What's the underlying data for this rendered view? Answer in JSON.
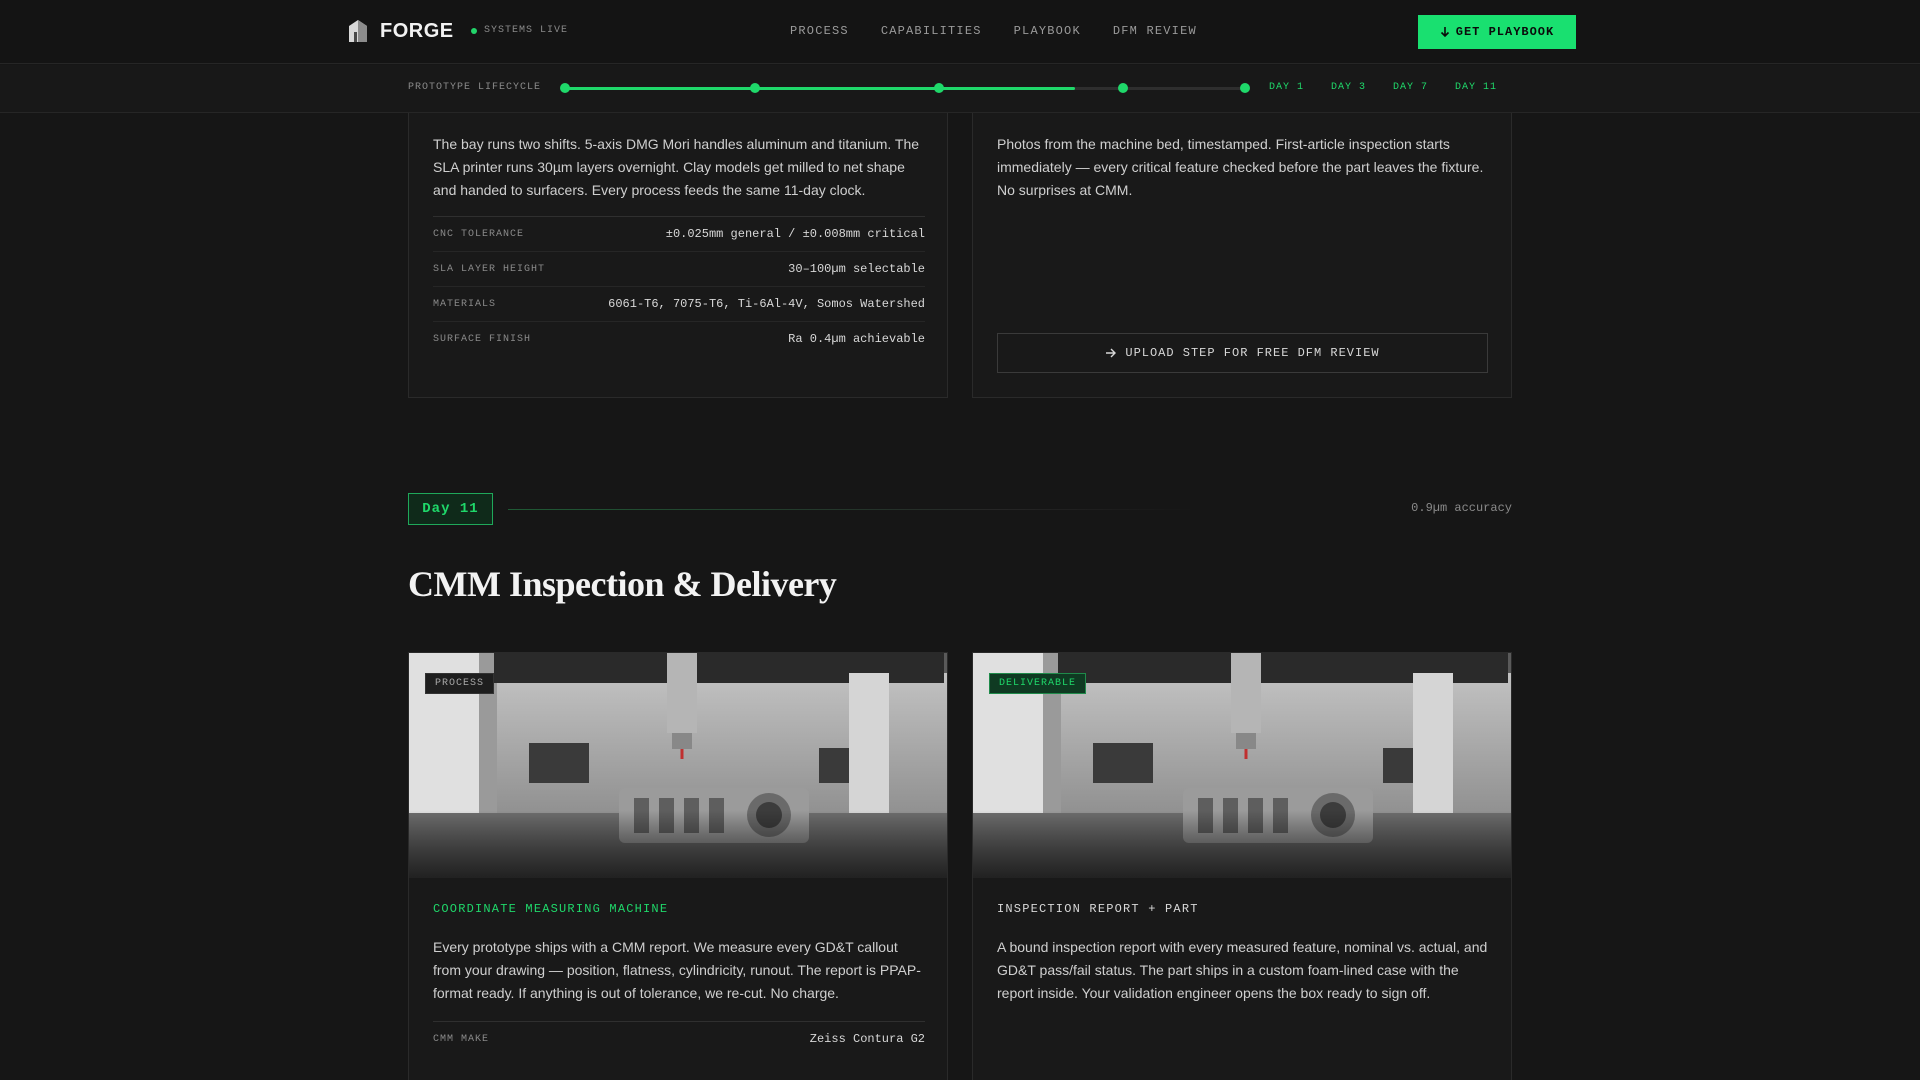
{
  "nav": {
    "brand": "FORGE",
    "status": "SYSTEMS LIVE",
    "links": [
      "PROCESS",
      "CAPABILITIES",
      "PLAYBOOK",
      "DFM REVIEW"
    ],
    "cta": "GET PLAYBOOK"
  },
  "lifecycle": {
    "label": "PROTOTYPE LIFECYCLE",
    "progress_percent": 75,
    "milestones_percent": [
      0,
      28,
      55,
      82,
      100
    ],
    "days": [
      "DAY 1",
      "DAY 3",
      "DAY 7",
      "DAY 11"
    ]
  },
  "shop_card": {
    "text": "The bay runs two shifts. 5-axis DMG Mori handles aluminum and titanium. The SLA printer runs 30µm layers overnight. Clay models get milled to net shape and handed to surfacers. Every process feeds the same 11-day clock.",
    "specs": [
      {
        "key": "CNC TOLERANCE",
        "value": "±0.025mm general / ±0.008mm critical"
      },
      {
        "key": "SLA LAYER HEIGHT",
        "value": "30–100µm selectable"
      },
      {
        "key": "MATERIALS",
        "value": "6061-T6, 7075-T6, Ti-6Al-4V, Somos Watershed"
      },
      {
        "key": "SURFACE FINISH",
        "value": "Ra 0.4µm achievable"
      }
    ]
  },
  "photo_card": {
    "text": "Photos from the machine bed, timestamped. First-article inspection starts immediately — every critical feature checked before the part leaves the fixture. No surprises at CMM.",
    "button": "UPLOAD STEP FOR FREE DFM REVIEW"
  },
  "day11": {
    "badge": "Day 11",
    "accuracy": "0.9µm accuracy",
    "title": "CMM Inspection & Delivery",
    "cards": [
      {
        "tag": "PROCESS",
        "heading": "COORDINATE MEASURING MACHINE",
        "text": "Every prototype ships with a CMM report. We measure every GD&T callout from your drawing — position, flatness, cylindricity, runout. The report is PPAP-format ready. If anything is out of tolerance, we re-cut. No charge.",
        "spec": {
          "key": "CMM MAKE",
          "value": "Zeiss Contura G2"
        }
      },
      {
        "tag": "DELIVERABLE",
        "heading": "INSPECTION REPORT + PART",
        "text": "A bound inspection report with every measured feature, nominal vs. actual, and GD&T pass/fail status. The part ships in a custom foam-lined case with the report inside. Your validation engineer opens the box ready to sign off."
      }
    ]
  },
  "colors": {
    "accent": "#1fd86a",
    "background": "#161616",
    "card": "#191919"
  }
}
